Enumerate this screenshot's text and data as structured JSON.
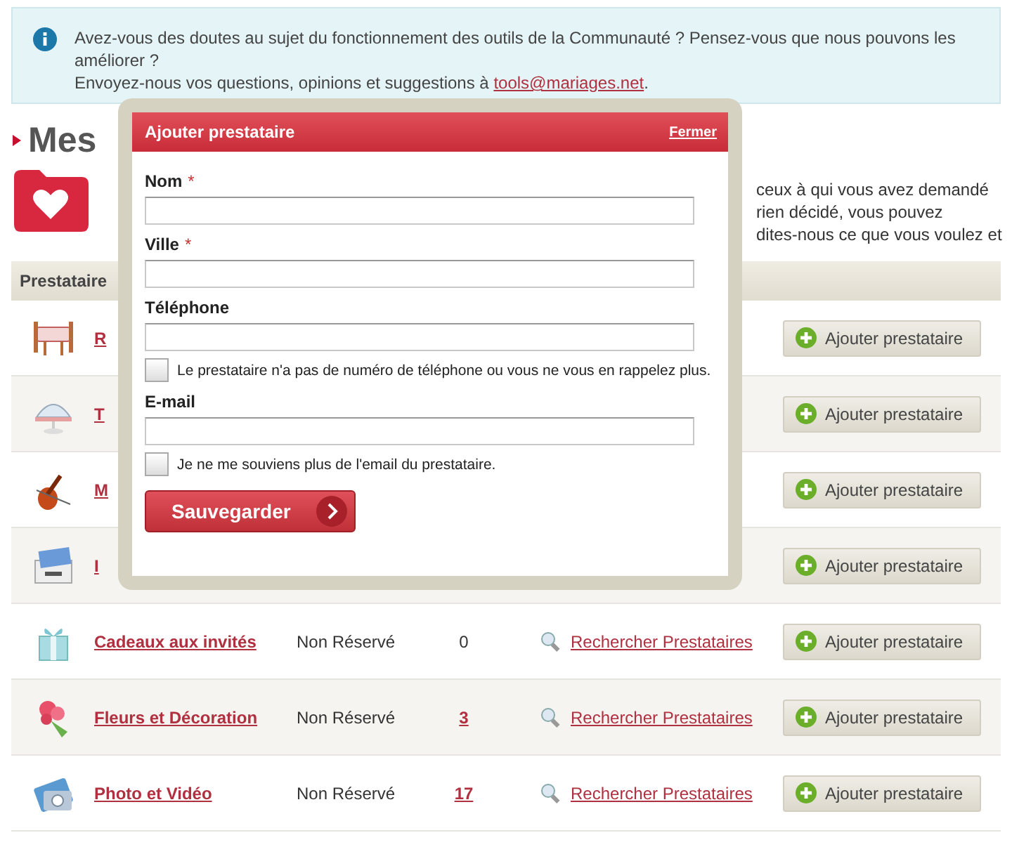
{
  "info_banner": {
    "text": "Avez-vous des doutes au sujet du fonctionnement des outils de la Communauté ? Pensez-vous que nous pouvons les améliorer ?",
    "text_2": "Envoyez-nous vos questions, opinions et suggestions à ",
    "link": "tools@mariages.net",
    "text_end": "."
  },
  "heading": "Mes",
  "intro_lines": [
    "ceux à qui vous avez demandé",
    "rien décidé, vous pouvez",
    "dites-nous ce que vous voulez et"
  ],
  "table": {
    "columns": [
      "Prestataire"
    ],
    "rows": [
      {
        "name": "R",
        "button": "Ajouter prestataire"
      },
      {
        "name": "T",
        "button": "Ajouter prestataire"
      },
      {
        "name": "M",
        "button": "Ajouter prestataire"
      },
      {
        "name": "I",
        "button": "Ajouter prestataire"
      },
      {
        "name": "Cadeaux aux invités",
        "status": "Non Réservé",
        "count": "0",
        "count_linked": false,
        "search": "Rechercher Prestataires",
        "button": "Ajouter prestataire"
      },
      {
        "name": "Fleurs et Décoration",
        "status": "Non Réservé",
        "count": "3",
        "count_linked": true,
        "search": "Rechercher Prestataires",
        "button": "Ajouter prestataire"
      },
      {
        "name": "Photo et Vidéo",
        "status": "Non Réservé",
        "count": "17",
        "count_linked": true,
        "search": "Rechercher Prestataires",
        "button": "Ajouter prestataire"
      }
    ]
  },
  "dialog": {
    "title": "Ajouter prestataire",
    "close": "Fermer",
    "fields": [
      {
        "label": "Nom",
        "mark": "*"
      },
      {
        "label": "Ville",
        "mark": "*"
      },
      {
        "label": "Téléphone",
        "checkbox": {
          "label": "Le prestataire n'a pas de numéro de téléphone ou vous ne vous en rappelez plus.",
          "checked": false
        }
      },
      {
        "label": "E-mail",
        "checkbox": {
          "label": "Je ne me souviens plus de l'email du prestataire.",
          "checked": false
        }
      }
    ],
    "submit": "Sauvegarder"
  }
}
